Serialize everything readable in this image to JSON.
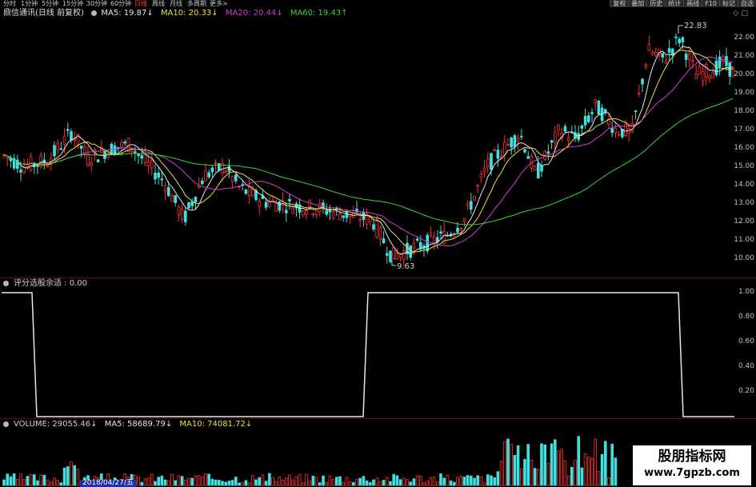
{
  "toolbar": {
    "periods": [
      "分时",
      "1分钟",
      "5分钟",
      "15分钟",
      "30分钟",
      "60分钟",
      "日线",
      "周线",
      "月线",
      "多周期",
      "更多>"
    ],
    "active_period": "日线",
    "tools": [
      "复权",
      "叠加",
      "历史",
      "统计",
      "画线",
      "F10",
      "标记",
      "自选"
    ]
  },
  "price_panel": {
    "title": "鼎信通讯(日线 前复权)",
    "ma5": "MA5: 19.87↓",
    "ma10": "MA10: 20.33↓",
    "ma20": "MA20: 20.44↓",
    "ma60": "MA60: 19.43↑",
    "high_label": "22.83",
    "low_label": "9.63",
    "y_labels": [
      "22.00",
      "21.00",
      "20.00",
      "19.00",
      "18.00",
      "17.00",
      "16.00",
      "15.00",
      "14.00",
      "13.00",
      "12.00",
      "11.00",
      "10.00"
    ]
  },
  "indicator_panel": {
    "title": "评分选股余适 : 0.00",
    "y_labels": [
      "1.00",
      "0.80",
      "0.60",
      "0.40",
      "0.20"
    ]
  },
  "volume_panel": {
    "volume": "VOLUME: 29055.46↓",
    "ma5": "MA5: 58689.79↓",
    "ma10": "MA10: 74081.72↓",
    "date_label": "2018/04/27/五"
  },
  "watermark": {
    "line1": "股朋指标网",
    "line2": "www.7gpzb.com"
  },
  "colors": {
    "up": "#ff3030",
    "down": "#40e0e0",
    "ma5": "#e6e6e6",
    "ma10": "#f0e040",
    "ma20": "#d040d0",
    "ma60": "#40d040"
  }
}
